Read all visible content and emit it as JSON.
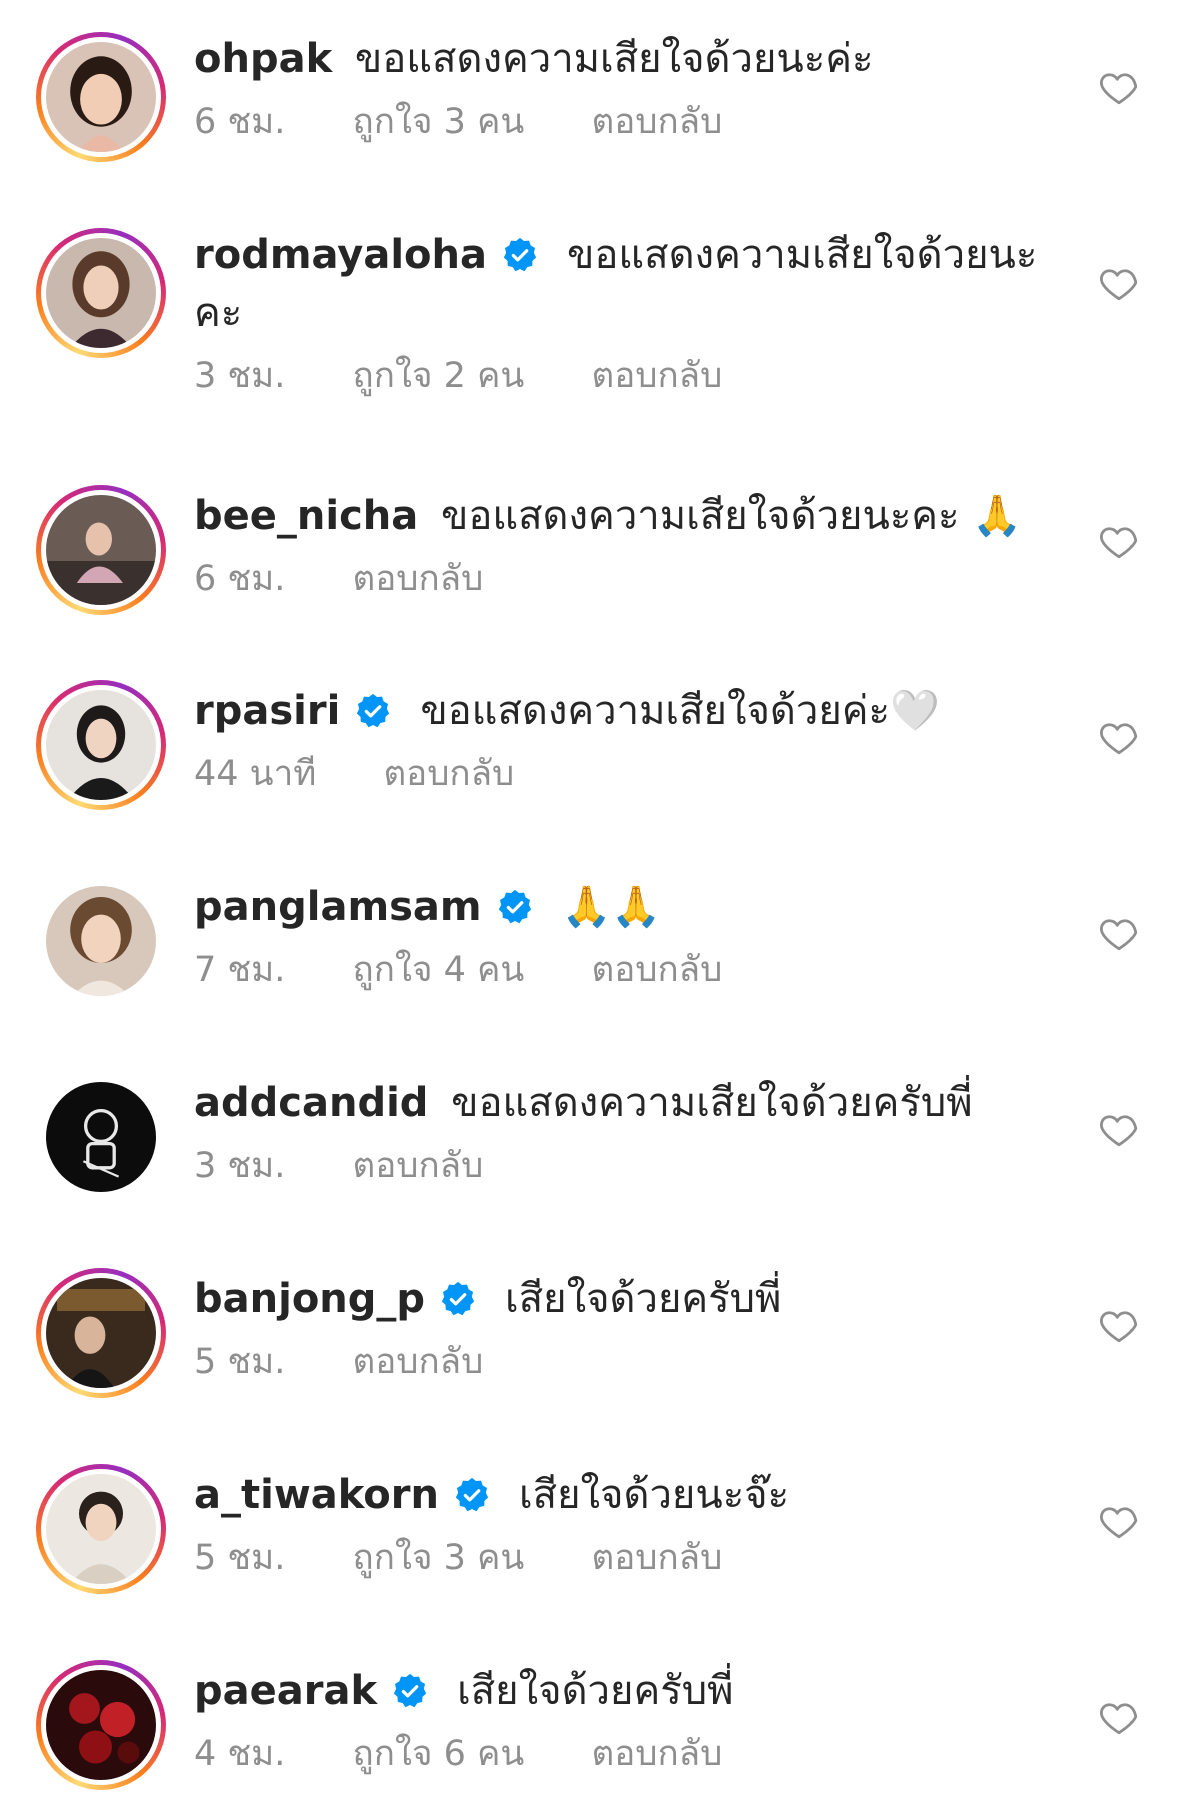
{
  "comments": [
    {
      "username": "ohpak",
      "verified": false,
      "text": "ขอแสดงความเสียใจด้วยนะค่ะ",
      "time": "6 ชม.",
      "likes": "ถูกใจ 3 คน",
      "reply": "ตอบกลับ"
    },
    {
      "username": "rodmayaloha",
      "verified": true,
      "text": "ขอแสดงความเสียใจด้วยนะคะ",
      "time": "3 ชม.",
      "likes": "ถูกใจ 2 คน",
      "reply": "ตอบกลับ"
    },
    {
      "username": "bee_nicha",
      "verified": false,
      "text": "ขอแสดงความเสียใจด้วยนะคะ 🙏",
      "time": "6 ชม.",
      "likes": "",
      "reply": "ตอบกลับ"
    },
    {
      "username": "rpasiri",
      "verified": true,
      "text": "ขอแสดงความเสียใจด้วยค่ะ🤍",
      "time": "44 นาที",
      "likes": "",
      "reply": "ตอบกลับ"
    },
    {
      "username": "panglamsam",
      "verified": true,
      "text": "🙏🙏",
      "time": "7 ชม.",
      "likes": "ถูกใจ 4 คน",
      "reply": "ตอบกลับ"
    },
    {
      "username": "addcandid",
      "verified": false,
      "text": "ขอแสดงความเสียใจด้วยครับพี่",
      "time": "3 ชม.",
      "likes": "",
      "reply": "ตอบกลับ"
    },
    {
      "username": "banjong_p",
      "verified": true,
      "text": "เสียใจด้วยครับพี่",
      "time": "5 ชม.",
      "likes": "",
      "reply": "ตอบกลับ"
    },
    {
      "username": "a_tiwakorn",
      "verified": true,
      "text": "เสียใจด้วยนะจ๊ะ",
      "time": "5 ชม.",
      "likes": "ถูกใจ 3 คน",
      "reply": "ตอบกลับ"
    },
    {
      "username": "paearak",
      "verified": true,
      "text": "เสียใจด้วยครับพี่",
      "time": "4 ชม.",
      "likes": "ถูกใจ 6 คน",
      "reply": "ตอบกลับ"
    }
  ],
  "icons": {
    "verified": "verified-badge-icon",
    "like": "heart-outline-icon"
  },
  "colors": {
    "text": "#262626",
    "meta": "#8e8e8e",
    "verified": "#0095f6"
  }
}
